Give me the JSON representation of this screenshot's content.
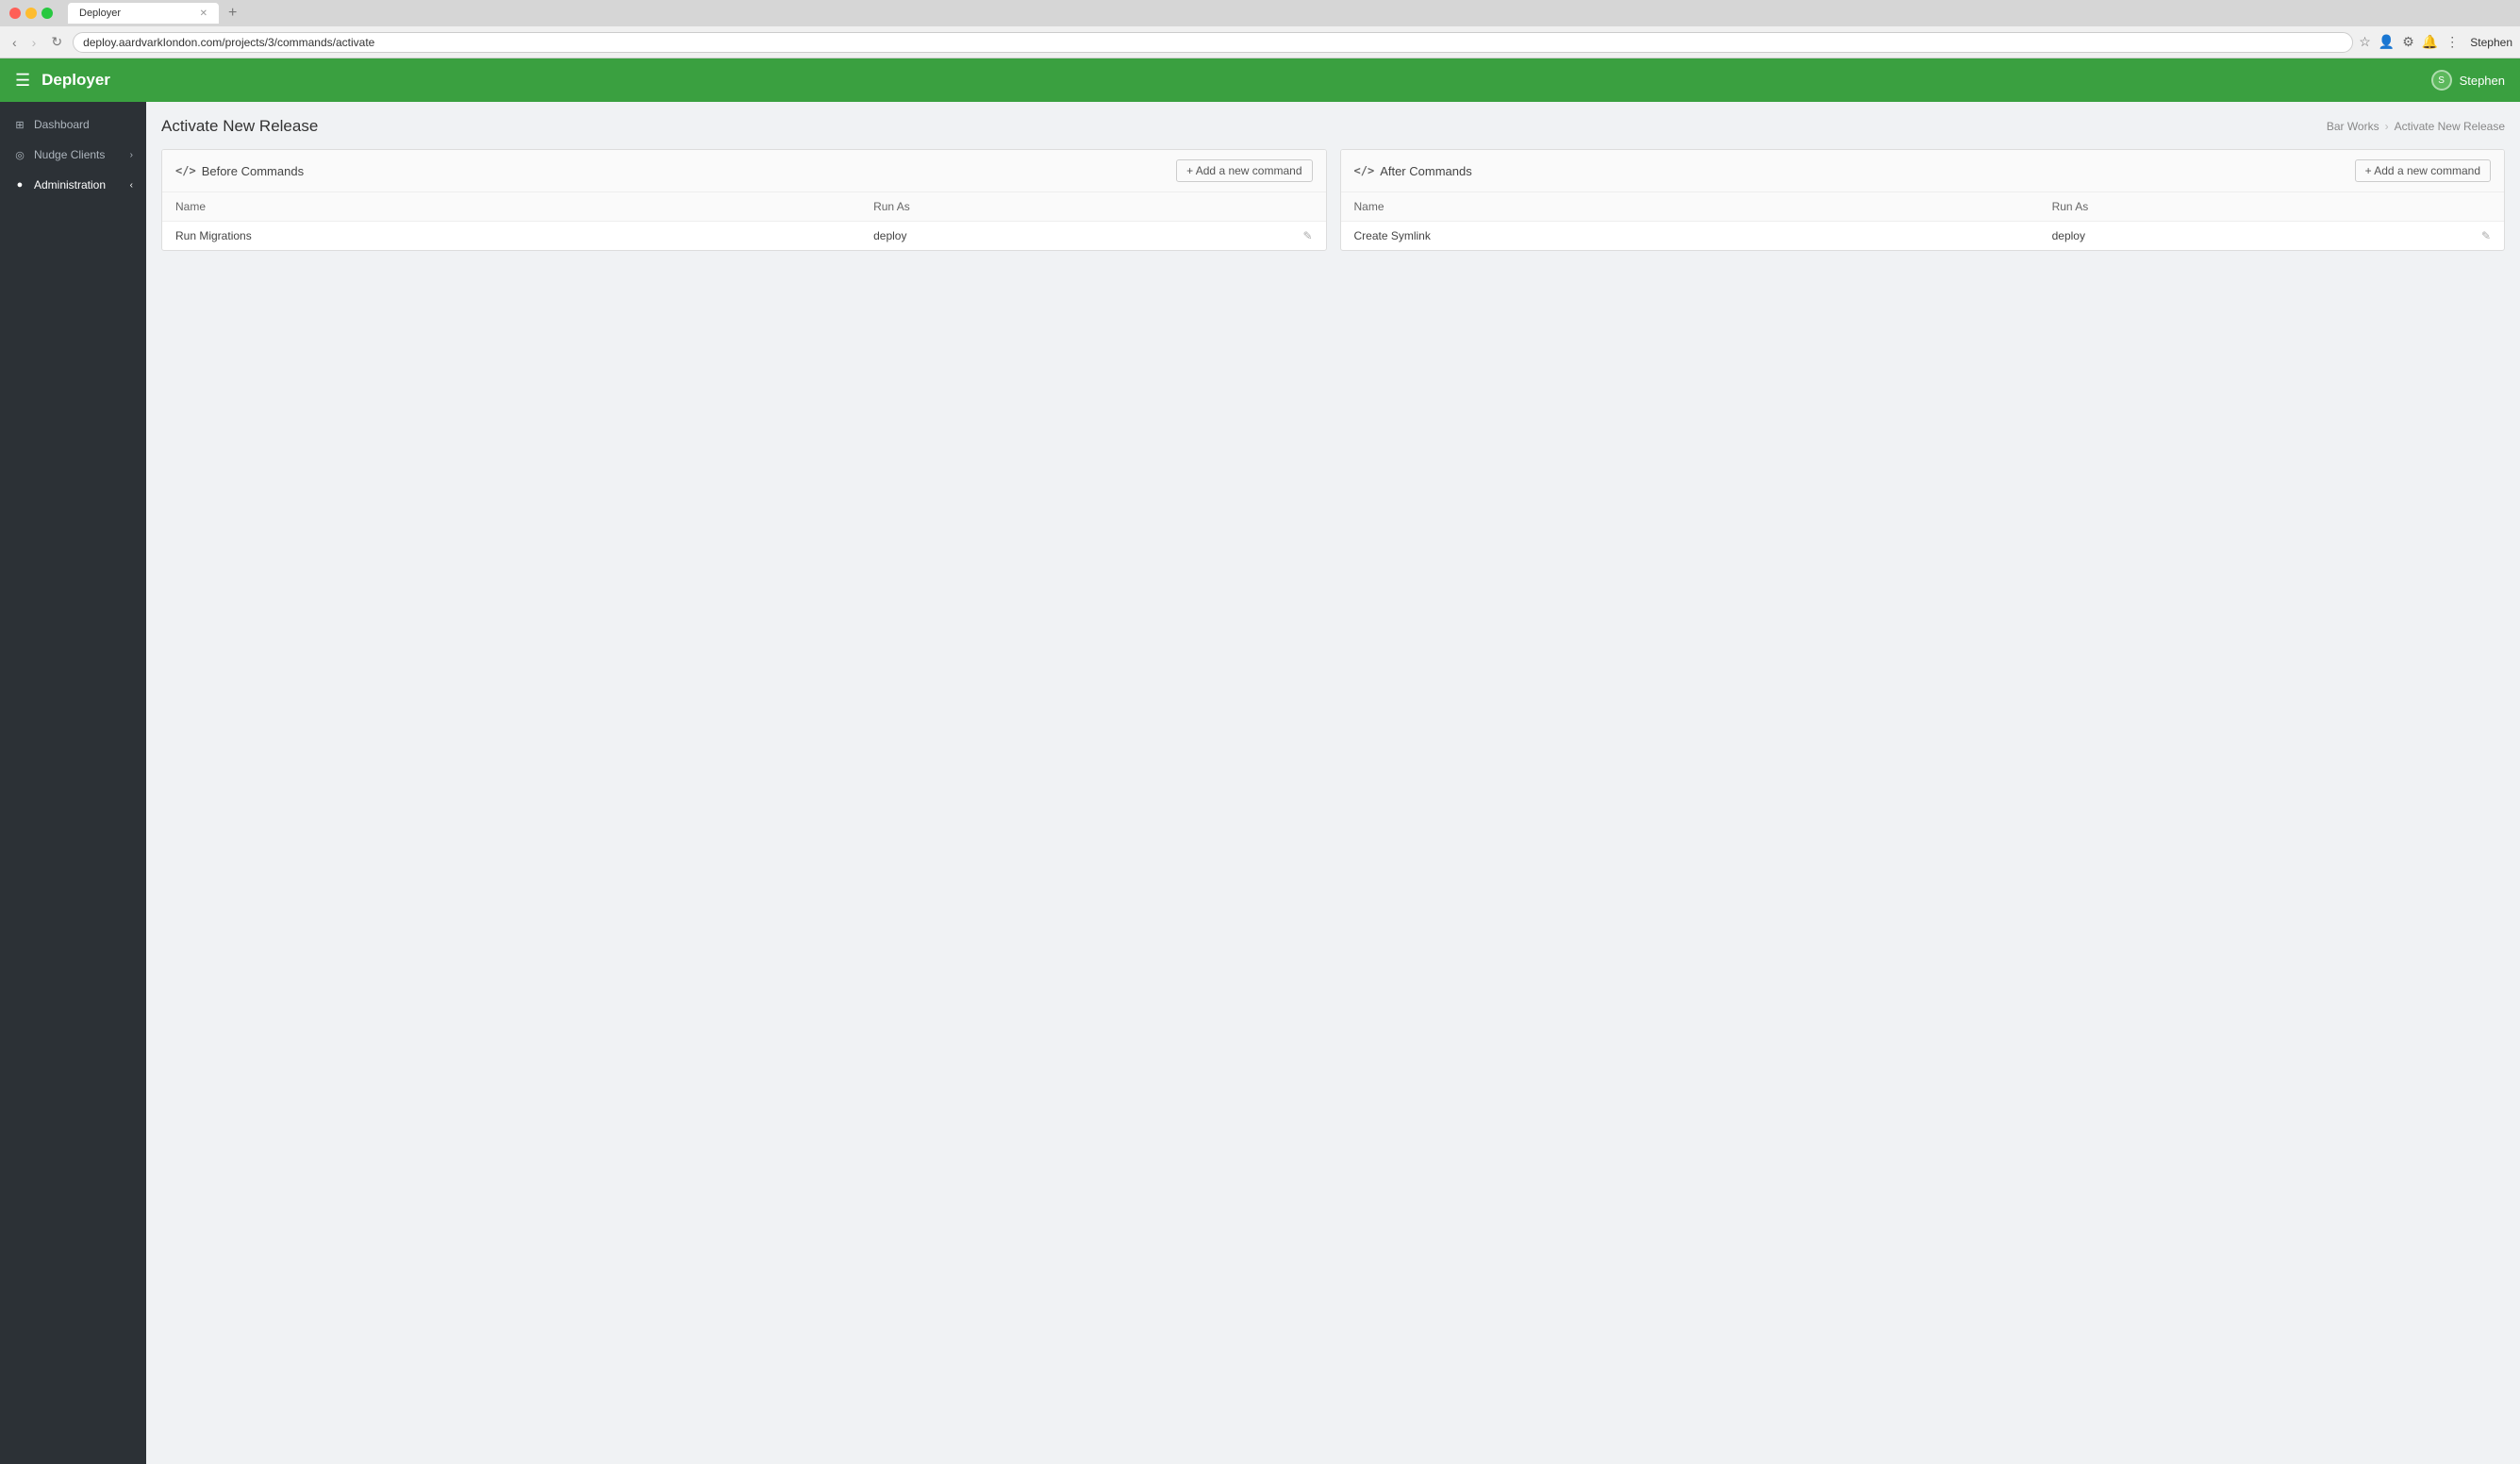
{
  "browser": {
    "tab_title": "Deployer",
    "url": "deploy.aardvarkIondon.com/projects/3/commands/activate",
    "user": "Stephen"
  },
  "topnav": {
    "logo": "Deployer",
    "user": "Stephen"
  },
  "sidebar": {
    "items": [
      {
        "id": "dashboard",
        "label": "Dashboard",
        "icon": "⊞",
        "has_chevron": false
      },
      {
        "id": "nudge-clients",
        "label": "Nudge Clients",
        "icon": "◎",
        "has_chevron": true
      },
      {
        "id": "administration",
        "label": "Administration",
        "icon": "●",
        "has_chevron": true
      }
    ]
  },
  "page": {
    "title": "Activate New Release",
    "breadcrumb": [
      {
        "label": "Bar Works"
      },
      {
        "label": "Activate New Release"
      }
    ]
  },
  "before_commands": {
    "title": "Before Commands",
    "add_btn": "+ Add a new command",
    "columns": {
      "name": "Name",
      "run_as": "Run As"
    },
    "rows": [
      {
        "name": "Run Migrations",
        "run_as": "deploy"
      }
    ]
  },
  "after_commands": {
    "title": "After Commands",
    "add_btn": "+ Add a new command",
    "columns": {
      "name": "Name",
      "run_as": "Run As"
    },
    "rows": [
      {
        "name": "Create Symlink",
        "run_as": "deploy"
      }
    ]
  },
  "colors": {
    "green": "#3aa040",
    "sidebar_bg": "#2c3136"
  }
}
